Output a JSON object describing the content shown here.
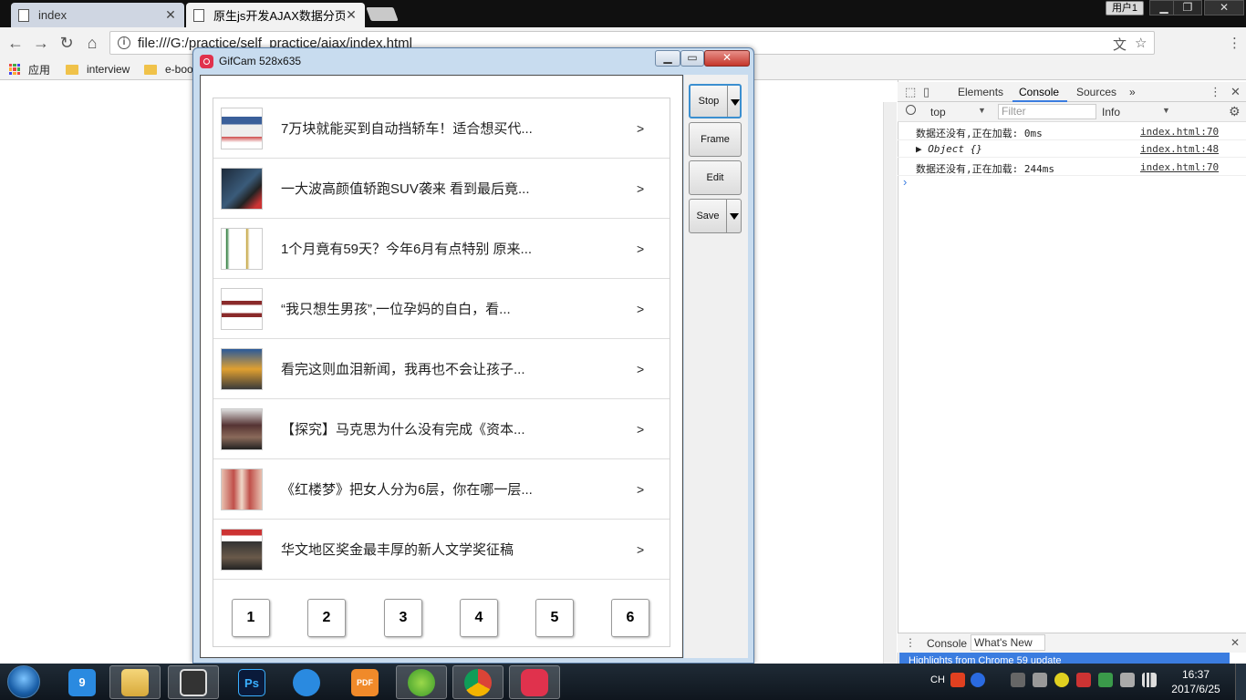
{
  "browser": {
    "tabs": [
      {
        "title": "index"
      },
      {
        "title": "原生js开发AJAX数据分页"
      }
    ],
    "user_label": "用户1",
    "url": "file:///G:/practice/self_practice/ajax/index.html",
    "bookmarks": [
      {
        "label": "应用"
      },
      {
        "label": "interview"
      },
      {
        "label": "e-boo"
      }
    ],
    "window_buttons": {
      "min": "▁",
      "max": "❐",
      "close": "✕"
    }
  },
  "devtools": {
    "tabs": [
      "Elements",
      "Console",
      "Sources",
      "»"
    ],
    "context": "top",
    "filter_placeholder": "Filter",
    "level": "Info",
    "logs": [
      {
        "text": "数据还没有,正在加载: 0ms",
        "source": "index.html:70"
      },
      {
        "text": "▶ Object {}",
        "source": "index.html:48"
      },
      {
        "text": "数据还没有,正在加载: 244ms",
        "source": "index.html:70"
      }
    ],
    "prompt": "›",
    "drawer_tabs": [
      "Console",
      "What's New"
    ],
    "drawer_highlight": "Highlights from Chrome 59 update"
  },
  "gifcam": {
    "title": "GifCam 528x635",
    "buttons": {
      "stop": "Stop",
      "frame": "Frame",
      "edit": "Edit",
      "save": "Save"
    },
    "window_buttons": {
      "min": "▁",
      "max": "▭",
      "close": "✕"
    }
  },
  "news": {
    "items": [
      {
        "title": "7万块就能买到自动挡轿车！适合想买代...",
        "arrow": ">"
      },
      {
        "title": "一大波高颜值轿跑SUV袭来 看到最后竟...",
        "arrow": ">"
      },
      {
        "title": "1个月竟有59天？今年6月有点特别 原来...",
        "arrow": ">"
      },
      {
        "title": "“我只想生男孩”,一位孕妈的自白，看...",
        "arrow": ">"
      },
      {
        "title": "看完这则血泪新闻，我再也不会让孩子...",
        "arrow": ">"
      },
      {
        "title": "【探究】马克思为什么没有完成《资本...",
        "arrow": ">"
      },
      {
        "title": "《红楼梦》把女人分为6层，你在哪一层...",
        "arrow": ">"
      },
      {
        "title": "华文地区奖金最丰厚的新人文学奖征稿",
        "arrow": ">"
      }
    ],
    "pages": [
      "1",
      "2",
      "3",
      "4",
      "5",
      "6"
    ]
  },
  "taskbar": {
    "apps": [
      {
        "icon": "baidu-netdisk-icon",
        "label": "9"
      },
      {
        "icon": "file-explorer-icon",
        "label": ""
      },
      {
        "icon": "sublime-icon",
        "label": ""
      },
      {
        "icon": "photoshop-icon",
        "label": "Ps"
      },
      {
        "icon": "feiq-icon",
        "label": ""
      },
      {
        "icon": "pdf-reader-icon",
        "label": "PDF"
      },
      {
        "icon": "green-app-icon",
        "label": ""
      },
      {
        "icon": "chrome-icon",
        "label": ""
      },
      {
        "icon": "gifcam-icon",
        "label": ""
      }
    ],
    "ime": "CH",
    "time": "16:37",
    "date": "2017/6/25"
  },
  "colors": {
    "taskbar": "#0f161e",
    "gifcam_frame": "#c8dcef",
    "devtools_highlight": "#3b7de0"
  }
}
